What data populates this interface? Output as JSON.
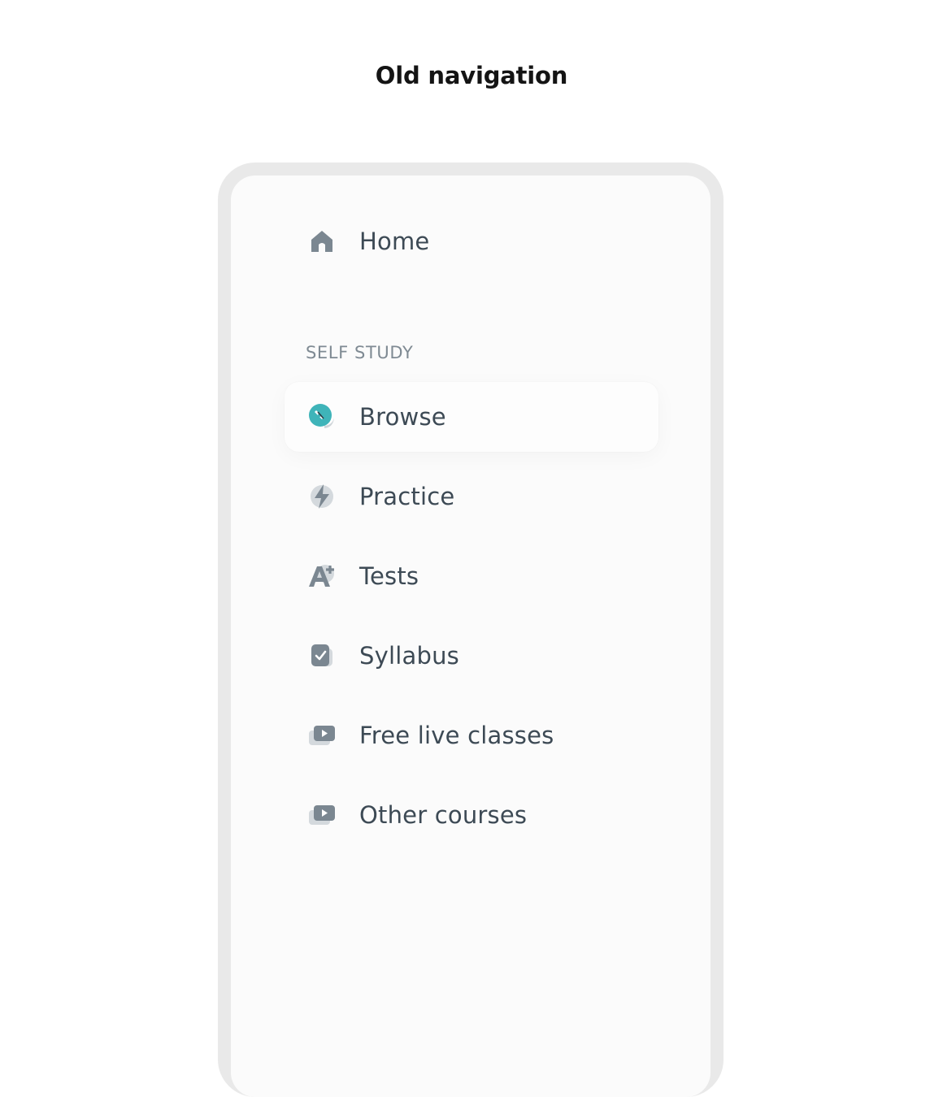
{
  "title": "Old navigation",
  "nav": {
    "home": {
      "label": "Home",
      "icon": "home-icon"
    },
    "section_heading": "SELF STUDY",
    "items": [
      {
        "label": "Browse",
        "icon": "compass-icon",
        "active": true,
        "accent": "#3fb4b9"
      },
      {
        "label": "Practice",
        "icon": "lightning-icon"
      },
      {
        "label": "Tests",
        "icon": "a-plus-icon"
      },
      {
        "label": "Syllabus",
        "icon": "checklist-icon"
      },
      {
        "label": "Free live classes",
        "icon": "video-play-icon"
      },
      {
        "label": "Other courses",
        "icon": "video-play-icon"
      }
    ]
  },
  "colors": {
    "icon_gray": "#7b8791",
    "label_text": "#3d4a55",
    "heading_text": "#7f8a93",
    "frame": "#e9e9e9",
    "screen": "#fbfbfb"
  }
}
